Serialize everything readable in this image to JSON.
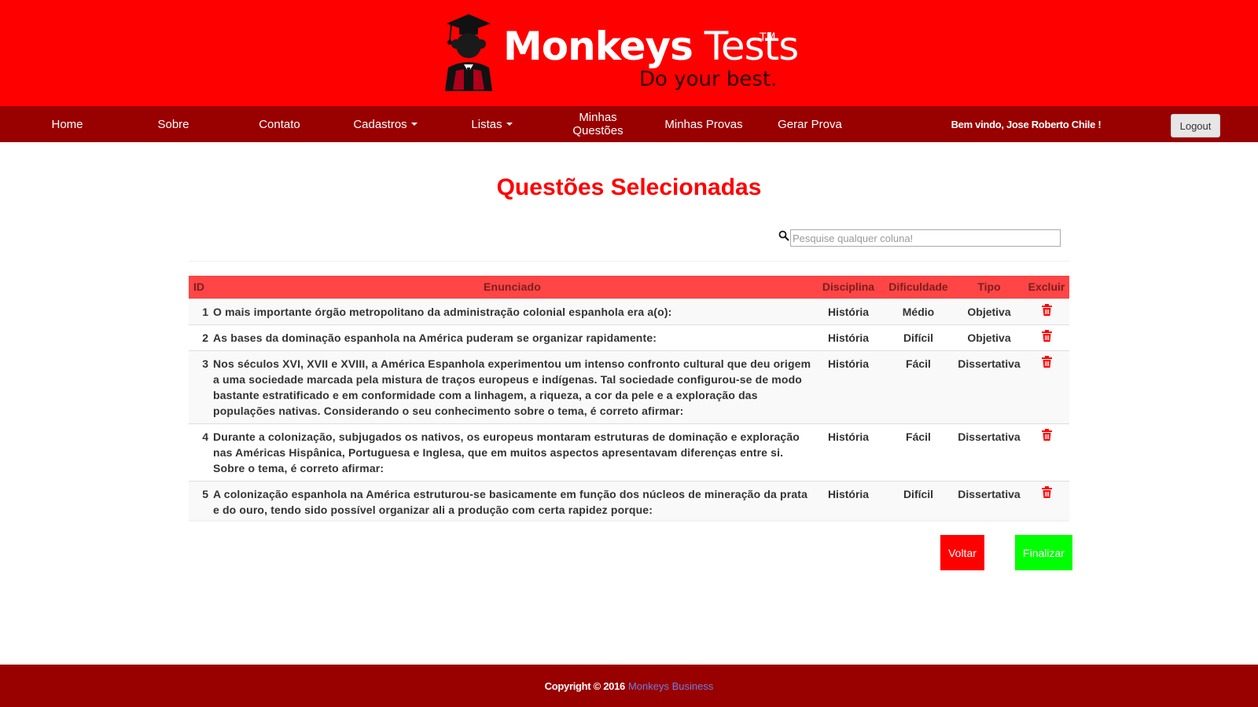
{
  "header": {
    "logo": {
      "title_bold": "Monkeys",
      "title_regular": " Tests",
      "trademark": "TM",
      "tagline": "Do your best.",
      "icon": "graduate-monkey-icon"
    }
  },
  "nav": {
    "items": [
      {
        "label": "Home"
      },
      {
        "label": "Sobre"
      },
      {
        "label": "Contato"
      },
      {
        "label": "Cadastros",
        "dropdown": true
      },
      {
        "label": "Listas",
        "dropdown": true
      },
      {
        "label_line1": "Minhas",
        "label_line2": "Questões"
      },
      {
        "label": "Minhas Provas"
      },
      {
        "label": "Gerar Prova"
      }
    ],
    "welcome": "Bem vindo, Jose Roberto Chile !",
    "logout_label": "Logout"
  },
  "main": {
    "title": "Questões Selecionadas",
    "search_placeholder": "Pesquise qualquer coluna!",
    "search_icon": "search-icon",
    "table": {
      "headers": [
        "ID",
        "Enunciado",
        "Disciplina",
        "Dificuldade",
        "Tipo",
        "Excluir"
      ],
      "rows": [
        {
          "id": "1",
          "enunciado": "O mais importante órgão metropolitano da administração colonial espanhola era a(o):",
          "disciplina": "História",
          "dificuldade": "Médio",
          "tipo": "Objetiva"
        },
        {
          "id": "2",
          "enunciado": "As bases da dominação espanhola na América puderam se organizar rapidamente:",
          "disciplina": "História",
          "dificuldade": "Difícil",
          "tipo": "Objetiva"
        },
        {
          "id": "3",
          "enunciado": "Nos séculos XVI, XVII e XVIII, a América Espanhola experimentou um intenso confronto cultural que deu origem a uma sociedade marcada pela mistura de traços europeus e indígenas. Tal sociedade configurou-se de modo bastante estratificado e em conformidade com a linhagem, a riqueza, a cor da pele e a exploração das populações nativas. Considerando o seu conhecimento sobre o tema, é correto afirmar:",
          "disciplina": "História",
          "dificuldade": "Fácil",
          "tipo": "Dissertativa"
        },
        {
          "id": "4",
          "enunciado": "Durante a colonização, subjugados os nativos, os europeus montaram estruturas de dominação e exploração nas Américas Hispânica, Portuguesa e Inglesa, que em muitos aspectos apresentavam diferenças entre si. Sobre o tema, é correto afirmar:",
          "disciplina": "História",
          "dificuldade": "Fácil",
          "tipo": "Dissertativa"
        },
        {
          "id": "5",
          "enunciado": "A colonização espanhola na América estruturou-se basicamente em função dos núcleos de mineração da prata e do ouro, tendo sido possível organizar ali a produção com certa rapidez porque:",
          "disciplina": "História",
          "dificuldade": "Difícil",
          "tipo": "Dissertativa"
        }
      ],
      "delete_icon": "trash-icon"
    },
    "buttons": {
      "voltar": "Voltar",
      "finalizar": "Finalizar"
    }
  },
  "footer": {
    "copyright": "Copyright © 2016",
    "link": "Monkeys Business"
  },
  "colors": {
    "header_red": "#ff0000",
    "nav_dark_red": "#990000",
    "table_header": "#ff4545",
    "finalizar_green": "#00ff00",
    "footer_link": "#6d7fd9"
  }
}
